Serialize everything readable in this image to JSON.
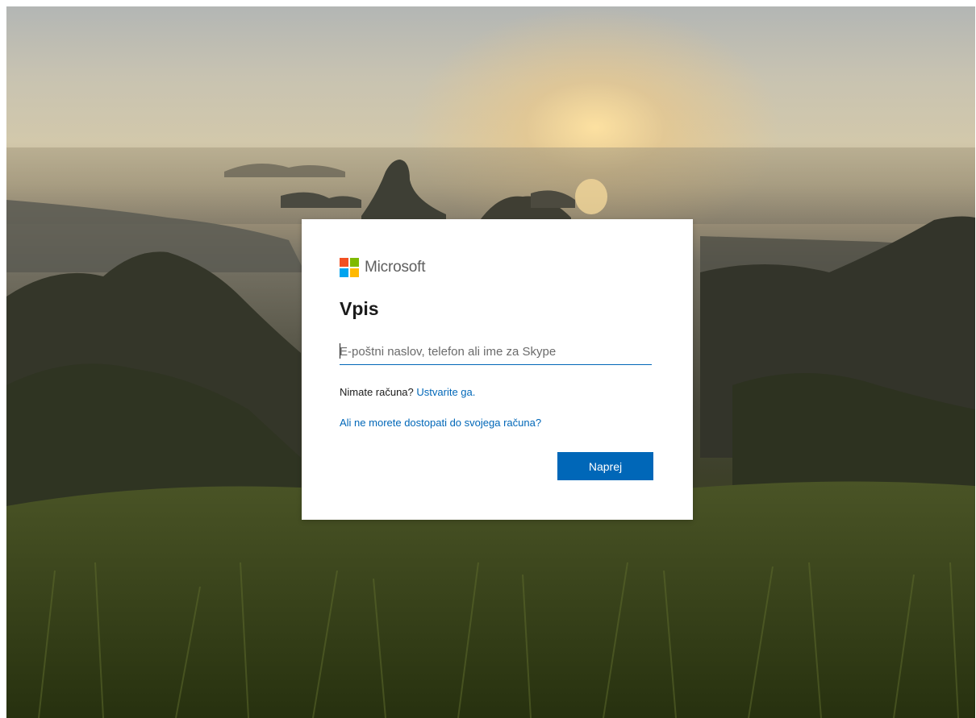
{
  "brand": {
    "name": "Microsoft",
    "logo_colors": [
      "#f25022",
      "#7fba00",
      "#00a4ef",
      "#ffb900"
    ]
  },
  "signin": {
    "title": "Vpis",
    "email_placeholder": "E-poštni naslov, telefon ali ime za Skype",
    "email_value": "",
    "no_account_text": "Nimate računa?",
    "create_account_link": "Ustvarite ga.",
    "cant_access_link": "Ali ne morete dostopati do svojega računa?",
    "next_button": "Naprej"
  },
  "colors": {
    "accent": "#0067b8",
    "text": "#1b1b1b",
    "logo_text": "#5e5e5e"
  },
  "background": {
    "scene": "background-photo"
  }
}
